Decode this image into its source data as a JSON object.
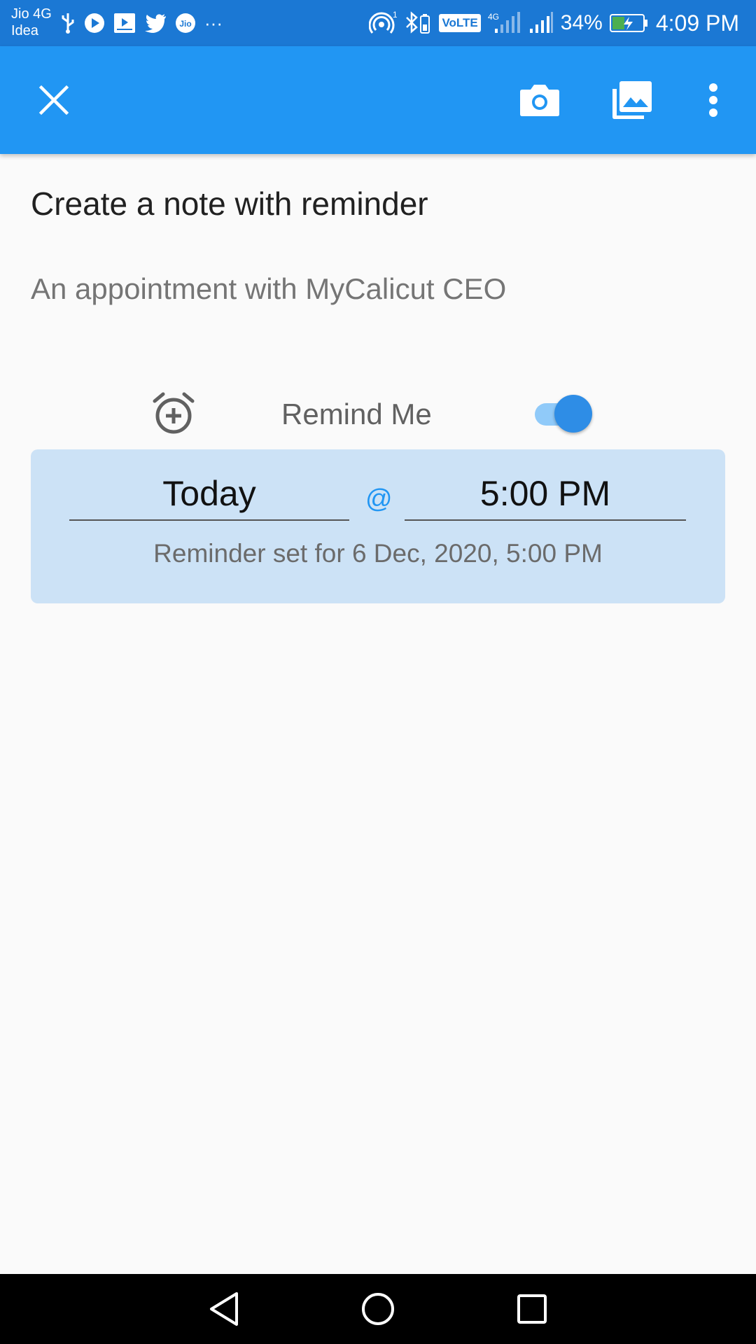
{
  "status_bar": {
    "carrier_line1": "Jio 4G",
    "carrier_line2": "Idea",
    "more_dots": "···",
    "volte": "VoLTE",
    "network": "4G",
    "battery_percent": "34%",
    "time": "4:09 PM",
    "hotspot_count": "1"
  },
  "app_bar": {
    "close_icon": "close-icon",
    "camera_icon": "camera-icon",
    "gallery_icon": "gallery-icon",
    "overflow_icon": "more-vert-icon",
    "color": "#2196f3"
  },
  "note": {
    "title": "Create a note with reminder",
    "body": "An appointment with MyCalicut CEO"
  },
  "reminder": {
    "label": "Remind Me",
    "enabled": true,
    "date": "Today",
    "at": "@",
    "time": "5:00 PM",
    "summary": "Reminder set for 6 Dec, 2020, 5:00 PM"
  },
  "nav_bar": {
    "back": "back-icon",
    "home": "home-icon",
    "recents": "recents-icon"
  }
}
